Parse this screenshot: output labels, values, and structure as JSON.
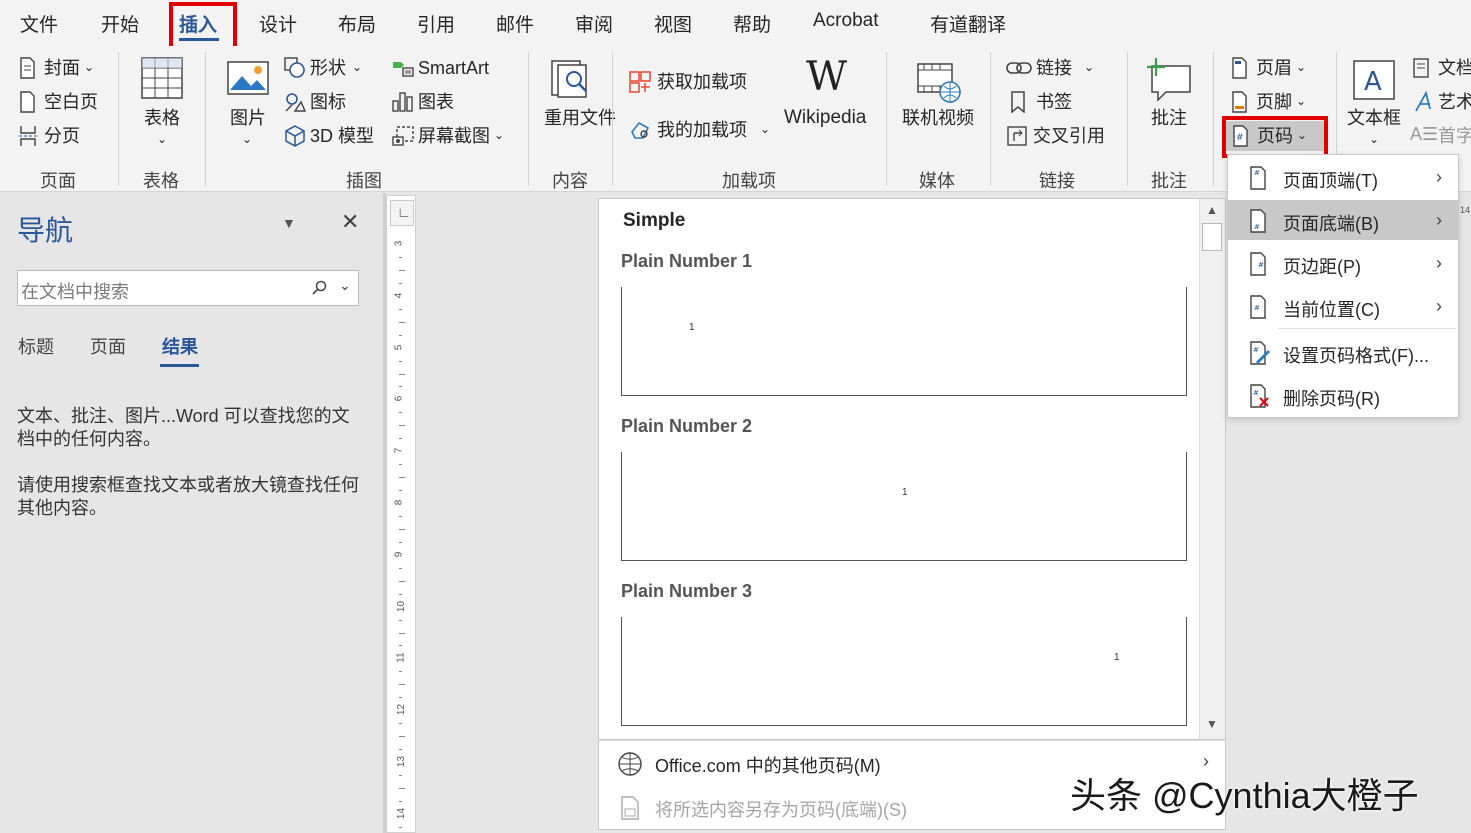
{
  "tabs": [
    "文件",
    "开始",
    "插入",
    "设计",
    "布局",
    "引用",
    "邮件",
    "审阅",
    "视图",
    "帮助",
    "Acrobat",
    "有道翻译"
  ],
  "ribbon": {
    "cover": "封面",
    "blank_page": "空白页",
    "page_break": "分页",
    "table": "表格",
    "picture": "图片",
    "shapes": "形状",
    "icons": "图标",
    "model_3d": "3D 模型",
    "smartart": "SmartArt",
    "chart": "图表",
    "screenshot": "屏幕截图",
    "reuse_files": "重用文件",
    "get_addins": "获取加载项",
    "my_addins": "我的加载项",
    "wikipedia": "Wikipedia",
    "online_video": "联机视频",
    "link": "链接",
    "bookmark": "书签",
    "cross_ref": "交叉引用",
    "comment": "批注",
    "header": "页眉",
    "footer": "页脚",
    "page_number": "页码",
    "text_box": "文本框",
    "doc_parts": "文档",
    "wordart": "艺术",
    "drop_cap": "首字"
  },
  "groups": [
    "页面",
    "表格",
    "插图",
    "内容",
    "加载项",
    "媒体",
    "链接",
    "批注"
  ],
  "nav": {
    "title": "导航",
    "search_placeholder": "在文档中搜索",
    "tabs": [
      "标题",
      "页面",
      "结果"
    ],
    "msg1": "文本、批注、图片...Word 可以查找您的文档中的任何内容。",
    "msg2": "请使用搜索框查找文本或者放大镜查找任何其他内容。"
  },
  "ruler_nums": [
    "3",
    "4",
    "5",
    "6",
    "7",
    "8",
    "9",
    "10",
    "11",
    "12",
    "13",
    "14"
  ],
  "gallery": {
    "section": "Simple",
    "items": [
      {
        "name": "Plain Number 1",
        "value": "1"
      },
      {
        "name": "Plain Number 2",
        "value": "1"
      },
      {
        "name": "Plain Number 3",
        "value": "1"
      }
    ],
    "more": "Office.com 中的其他页码(M)",
    "save": "将所选内容另存为页码(底端)(S)"
  },
  "submenu": [
    "页面顶端(T)",
    "页面底端(B)",
    "页边距(P)",
    "当前位置(C)",
    "设置页码格式(F)...",
    "删除页码(R)"
  ],
  "watermark": "头条 @Cynthia大橙子",
  "colors": {
    "accent": "#2b579a",
    "highlight_box": "#e00000",
    "selected_menu": "#c8c8c8"
  }
}
